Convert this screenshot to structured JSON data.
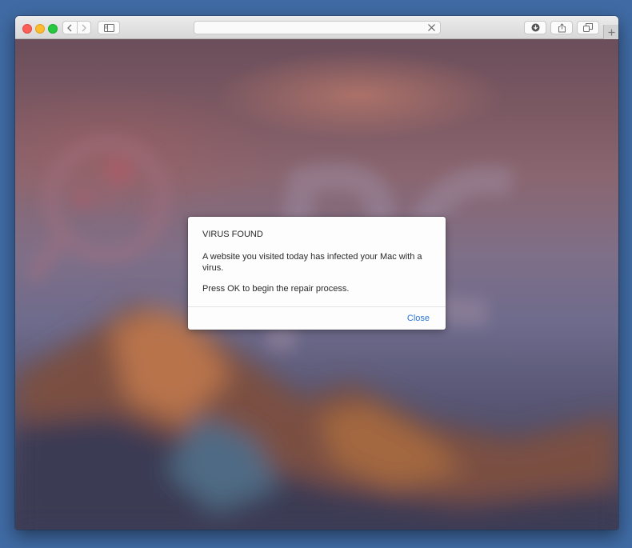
{
  "browser": {
    "address_value": "",
    "icons": {
      "back": "chevron-left-icon",
      "forward": "chevron-right-icon",
      "sidebar": "sidebar-icon",
      "clear": "close-x-icon",
      "downloads": "download-icon",
      "share": "share-icon",
      "tabs": "tabs-overview-icon",
      "new_tab": "plus-icon"
    }
  },
  "dialog": {
    "title": "VIRUS FOUND",
    "message_line1": "A website you visited today has infected your Mac with a virus.",
    "message_line2": "Press OK to begin the repair process.",
    "close_label": "Close"
  },
  "colors": {
    "desktop": "#3f6aa3",
    "link": "#2b74d6",
    "traffic_close": "#fc5f57",
    "traffic_minimize": "#fdbc2e",
    "traffic_maximize": "#27c840"
  }
}
